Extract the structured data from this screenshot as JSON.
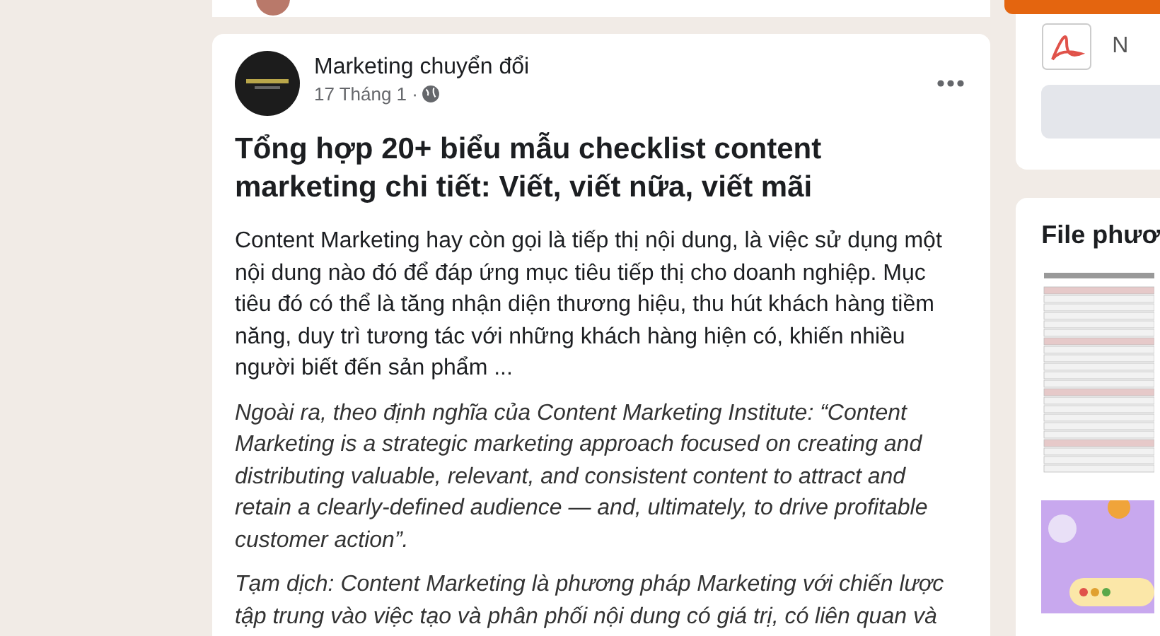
{
  "post": {
    "author": "Marketing chuyển đổi",
    "date": "17 Tháng 1 ·",
    "title": "Tổng hợp 20+ biểu mẫu checklist content marketing chi tiết: Viết, viết nữa, viết mãi",
    "paragraphs": [
      {
        "kind": "normal",
        "text": "Content Marketing hay còn gọi là tiếp thị nội dung, là việc sử dụng một nội dung nào đó để đáp ứng mục tiêu tiếp thị cho doanh nghiệp. Mục tiêu đó có thể là tăng nhận diện thương hiệu, thu hút khách hàng tiềm năng, duy trì tương tác với những khách hàng hiện có, khiến nhiều người biết đến sản phẩm ..."
      },
      {
        "kind": "italic",
        "text": "Ngoài ra, theo định nghĩa của Content Marketing Institute: “Content Marketing is a strategic marketing approach focused on creating and distributing valuable, relevant, and consistent content to attract and retain a clearly-defined audience — and, ultimately, to drive profitable customer action”."
      },
      {
        "kind": "italic",
        "text": "Tạm dịch: Content Marketing là phương pháp Marketing với chiến lược tập trung vào việc tạo và phân phối nội dung có giá trị, có liên quan và"
      }
    ]
  },
  "sidebar": {
    "file_label": "N",
    "files_title": "File phươ"
  }
}
